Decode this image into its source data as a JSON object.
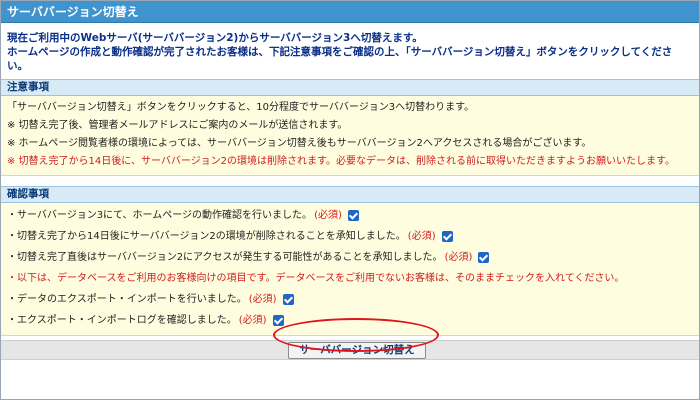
{
  "title": "サーババージョン切替え",
  "intro": {
    "line1": "現在ご利用中のWebサーバ(サーババージョン2)からサーババージョン3へ切替えます。",
    "line2": "ホームページの作成と動作確認が完了されたお客様は、下記注意事項をご確認の上、「サーババージョン切替え」ボタンをクリックしてください。"
  },
  "notes": {
    "heading": "注意事項",
    "lines": [
      "「サーババージョン切替え」ボタンをクリックすると、10分程度でサーババージョン3へ切替わります。",
      "※ 切替え完了後、管理者メールアドレスにご案内のメールが送信されます。",
      "※ ホームページ閲覧者様の環境によっては、サーババージョン切替え後もサーババージョン2へアクセスされる場合がございます。",
      "※ 切替え完了から14日後に、サーババージョン2の環境は削除されます。必要なデータは、削除される前に取得いただきますようお願いいたします。"
    ]
  },
  "checks": {
    "heading": "確認事項",
    "required_label": "(必須)",
    "items": [
      "・サーババージョン3にて、ホームページの動作確認を行いました。",
      "・切替え完了から14日後にサーババージョン2の環境が削除されることを承知しました。",
      "・切替え完了直後はサーババージョン2にアクセスが発生する可能性があることを承知しました。",
      "・データのエクスポート・インポートを行いました。",
      "・エクスポート・インポートログを確認しました。"
    ],
    "db_note": "・以下は、データベースをご利用のお客様向けの項目です。データベースをご利用でないお客様は、そのままチェックを入れてください。"
  },
  "button": {
    "label": "サーババージョン切替え"
  },
  "colors": {
    "header": "#3f93cf",
    "section": "#d9eaf7",
    "note_bg": "#fffde0",
    "alert": "#d11c1c",
    "highlight": "#e0141a"
  }
}
